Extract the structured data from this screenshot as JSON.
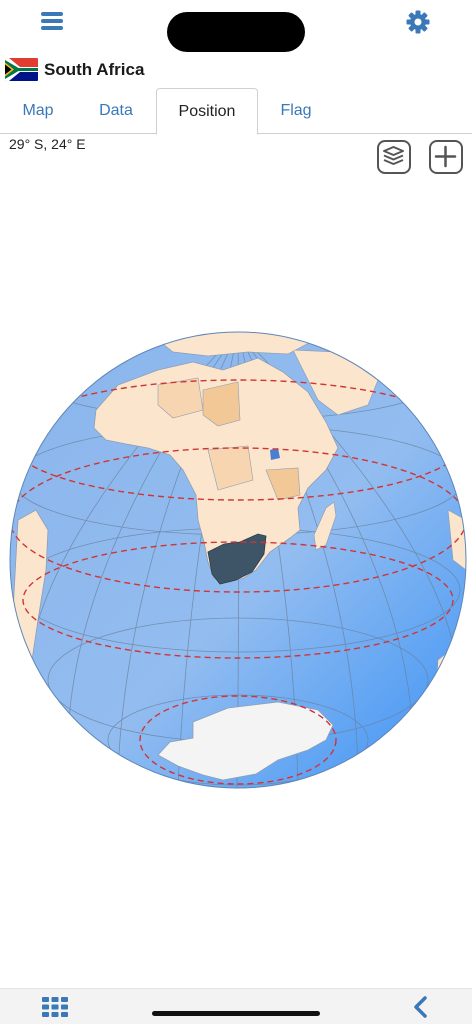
{
  "header": {
    "menu_icon": "hamburger-menu-icon",
    "settings_icon": "gear-icon"
  },
  "country": {
    "name": "South Africa",
    "flag_icon": "south-africa-flag-icon"
  },
  "tabs": [
    {
      "label": "Map",
      "active": false
    },
    {
      "label": "Data",
      "active": false
    },
    {
      "label": "Position",
      "active": true
    },
    {
      "label": "Flag",
      "active": false
    }
  ],
  "position": {
    "coordinates": "29° S, 24° E"
  },
  "tools": {
    "layers_icon": "layers-icon",
    "add_icon": "plus-icon"
  },
  "bottom": {
    "grid_icon": "grid-icon",
    "back_icon": "chevron-left-icon"
  },
  "colors": {
    "accent": "#3a78b8",
    "ocean": "#8fb9ee",
    "ocean_edge": "#3d94f5",
    "land": "#fbe5cc",
    "land_dark": "#f2c896",
    "highlight": "#3d5566",
    "antarctica": "#f4f4f4",
    "circles": "#d23434"
  }
}
